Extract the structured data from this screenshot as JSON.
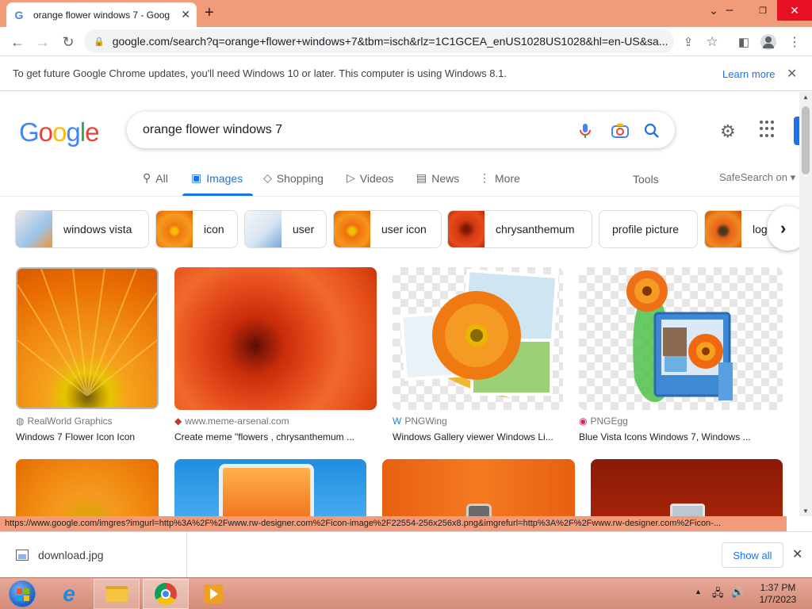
{
  "browser": {
    "tab_title": "orange flower windows 7 - Goog",
    "url": "google.com/search?q=orange+flower+windows+7&tbm=isch&rlz=1C1GCEA_enUS1028US1028&hl=en-US&sa...",
    "infobar_text": "To get future Google Chrome updates, you'll need Windows 10 or later. This computer is using Windows 8.1.",
    "infobar_link": "Learn more",
    "status_url": "https://www.google.com/imgres?imgurl=http%3A%2F%2Fwww.rw-designer.com%2Ficon-image%2F22554-256x256x8.png&imgrefurl=http%3A%2F%2Fwww.rw-designer.com%2Ficon-..."
  },
  "search": {
    "query": "orange flower windows 7",
    "logo_letters": [
      "G",
      "o",
      "o",
      "g",
      "l",
      "e"
    ],
    "logo_colors": [
      "#4285f4",
      "#ea4335",
      "#fbbc05",
      "#4285f4",
      "#34a853",
      "#ea4335"
    ],
    "tabs": [
      {
        "label": "All",
        "icon": "search-icon"
      },
      {
        "label": "Images",
        "icon": "image-icon"
      },
      {
        "label": "Shopping",
        "icon": "tag-icon"
      },
      {
        "label": "Videos",
        "icon": "play-icon"
      },
      {
        "label": "News",
        "icon": "newspaper-icon"
      },
      {
        "label": "More",
        "icon": "more-vert-icon"
      }
    ],
    "tools": "Tools",
    "safesearch": "SafeSearch on"
  },
  "chips": [
    {
      "label": "windows vista"
    },
    {
      "label": "icon"
    },
    {
      "label": "user"
    },
    {
      "label": "user icon"
    },
    {
      "label": "chrysanthemum"
    },
    {
      "label": "profile picture"
    },
    {
      "label": "logo"
    }
  ],
  "results": [
    {
      "source": "RealWorld Graphics",
      "title": "Windows 7 Flower Icon Icon"
    },
    {
      "source": "www.meme-arsenal.com",
      "title": "Create meme \"flowers , chrysanthemum ..."
    },
    {
      "source": "PNGWing",
      "title": "Windows Gallery viewer Windows Li..."
    },
    {
      "source": "PNGEgg",
      "title": "Blue Vista Icons Windows 7, Windows ..."
    }
  ],
  "downloads": {
    "file": "download.jpg",
    "show_all": "Show all"
  },
  "taskbar": {
    "time": "1:37 PM",
    "date": "1/7/2023"
  },
  "colors": {
    "accent": "#1a73e8",
    "titlebar": "#f29b7a"
  }
}
